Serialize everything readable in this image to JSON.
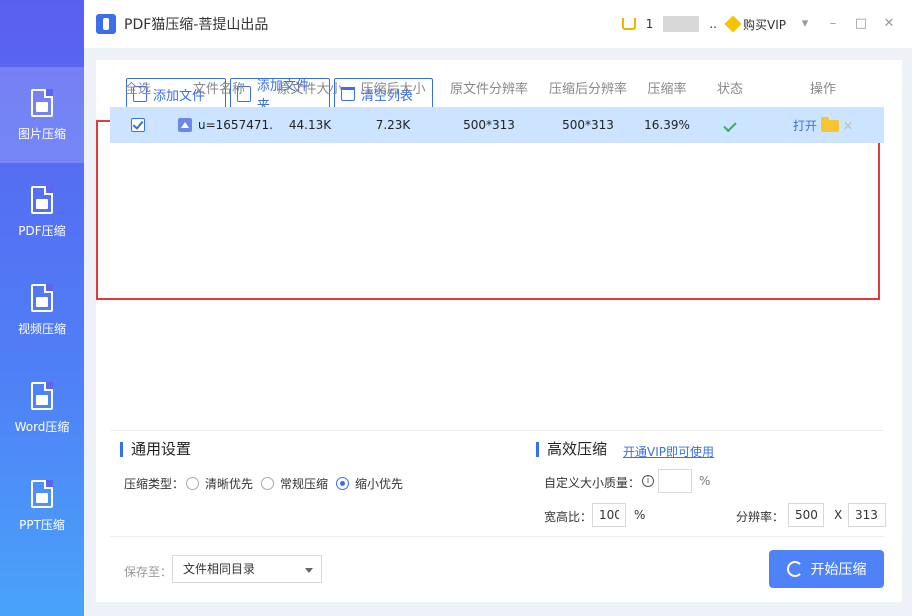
{
  "window": {
    "title": "PDF猫压缩-菩提山出品",
    "user_name": "1",
    "user_suffix": "..",
    "buy_vip": "购买VIP",
    "btn_menu": "▾",
    "btn_min": "–",
    "btn_max": "□",
    "btn_close": "✕"
  },
  "sidebar": {
    "items": [
      {
        "label": "图片压缩",
        "active": true
      },
      {
        "label": "PDF压缩"
      },
      {
        "label": "视频压缩"
      },
      {
        "label": "Word压缩"
      },
      {
        "label": "PPT压缩"
      }
    ]
  },
  "toolbar": {
    "add_file": "添加文件",
    "add_folder": "添加文件夹",
    "clear_list": "清空列表"
  },
  "table": {
    "headers": [
      "全选",
      "文件名称",
      "原文件大小",
      "压缩后大小",
      "原文件分辨率",
      "压缩后分辨率",
      "压缩率",
      "状态",
      "操作"
    ],
    "rows": [
      {
        "name": "u=1657471...",
        "orig_size": "44.13K",
        "comp_size": "7.23K",
        "orig_res": "500*313",
        "comp_res": "500*313",
        "ratio": "16.39%",
        "action_open": "打开",
        "action_remove": "✕"
      }
    ]
  },
  "general_settings": {
    "title": "通用设置",
    "compress_type_label": "压缩类型：",
    "options": [
      "清晰优先",
      "常规压缩",
      "缩小优先"
    ],
    "selected": "缩小优先"
  },
  "efficient": {
    "title": "高效压缩",
    "vip_link": "开通VIP即可使用",
    "custom_quality_label": "自定义大小质量：",
    "info_icon": "i",
    "quality_value": "",
    "quality_unit": "%",
    "aspect_label": "宽高比：",
    "aspect_value": "100",
    "aspect_unit": "%",
    "resolution_label": "分辨率：",
    "res_width": "500",
    "res_sep": "X",
    "res_height": "313"
  },
  "footer": {
    "save_to_label": "保存至：",
    "save_to_value": "文件相同目录",
    "start_button": "开始压缩"
  },
  "colors": {
    "accent": "#3a6fe6",
    "selected_row": "#cce4ff",
    "highlight_border": "#e53a3a"
  }
}
